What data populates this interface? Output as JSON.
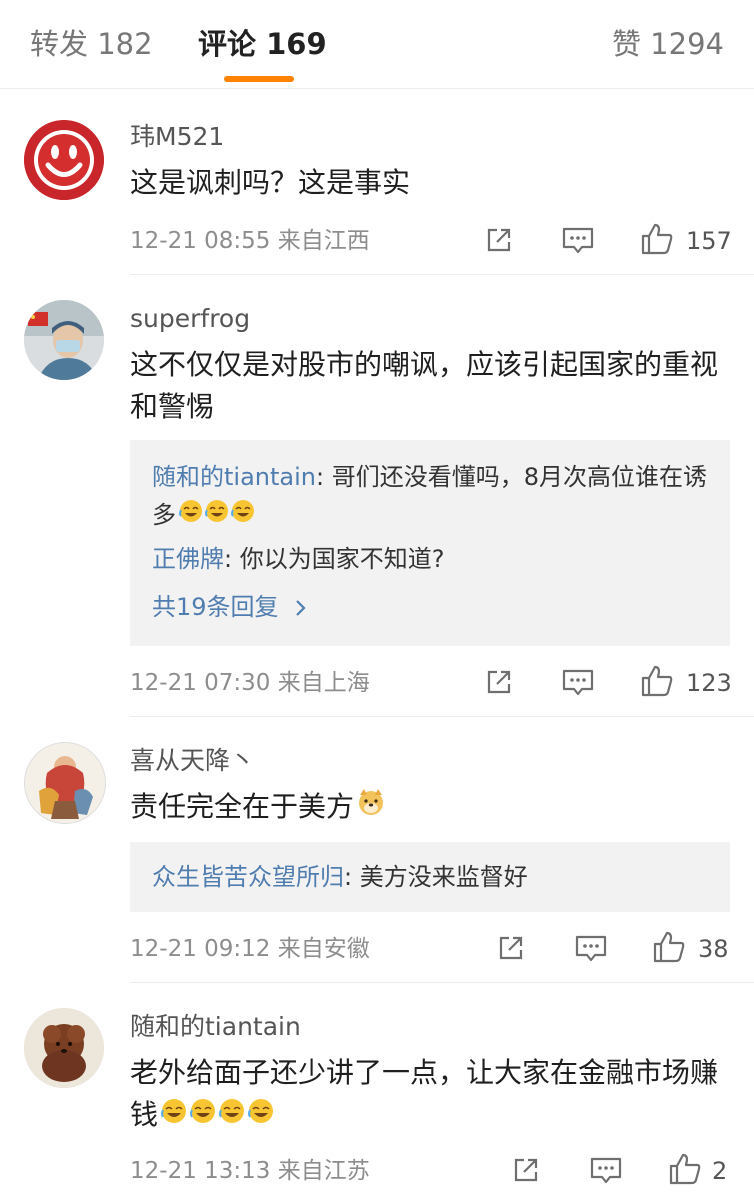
{
  "tabs": {
    "repost": "转发 182",
    "comment": "评论 169",
    "like": "赞 1294"
  },
  "comments": [
    {
      "author": "玮M521",
      "text": "这是讽刺吗？这是事实",
      "time": "12-21 08:55",
      "location": "来自江西",
      "likes": "157"
    },
    {
      "author": "superfrog",
      "text": "这不仅仅是对股市的嘲讽，应该引起国家的重视和警惕",
      "replies": [
        {
          "user": "随和的tiantain",
          "sep": ": ",
          "text": "哥们还没看懂吗，8月次高位谁在诱多"
        },
        {
          "user": "正佛牌",
          "sep": ": ",
          "text": "你以为国家不知道?"
        }
      ],
      "more": "共19条回复",
      "time": "12-21 07:30",
      "location": "来自上海",
      "likes": "123"
    },
    {
      "author": "喜从天降丶",
      "text": "责任完全在于美方",
      "replies": [
        {
          "user": "众生皆苦众望所归",
          "sep": ": ",
          "text": "美方没来监督好"
        }
      ],
      "time": "12-21 09:12",
      "location": "来自安徽",
      "likes": "38"
    },
    {
      "author": "随和的tiantain",
      "text": "老外给面子还少讲了一点，让大家在金融市场赚钱",
      "time": "12-21 13:13",
      "location": "来自江苏",
      "likes": "2"
    }
  ],
  "colors": {
    "accent": "#ff8200",
    "link": "#507daf",
    "meta": "#8d8d8d"
  },
  "icons": [
    "share-icon",
    "comment-icon",
    "thumbs-up-icon",
    "chevron-right-icon",
    "laughing-crying-emoji",
    "doge-emoji"
  ]
}
